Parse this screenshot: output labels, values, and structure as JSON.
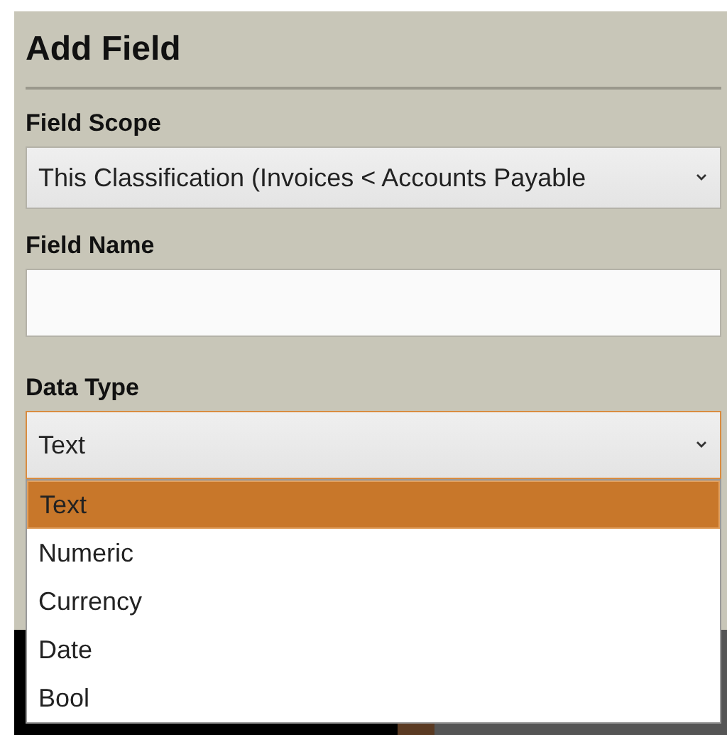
{
  "title": "Add Field",
  "fields": [
    {
      "kind": "select",
      "label": "Field Scope",
      "value": "This Classification (Invoices < Accounts Payable",
      "expanded": false
    },
    {
      "kind": "input",
      "label": "Field Name"
    },
    {
      "kind": "select",
      "label": "Data Type",
      "value": "Text",
      "expanded": true,
      "options": [
        {
          "label": "Text",
          "selected": true
        },
        {
          "label": "Numeric",
          "selected": false
        },
        {
          "label": "Currency",
          "selected": false
        },
        {
          "label": "Date",
          "selected": false
        },
        {
          "label": "Bool",
          "selected": false
        }
      ]
    }
  ]
}
